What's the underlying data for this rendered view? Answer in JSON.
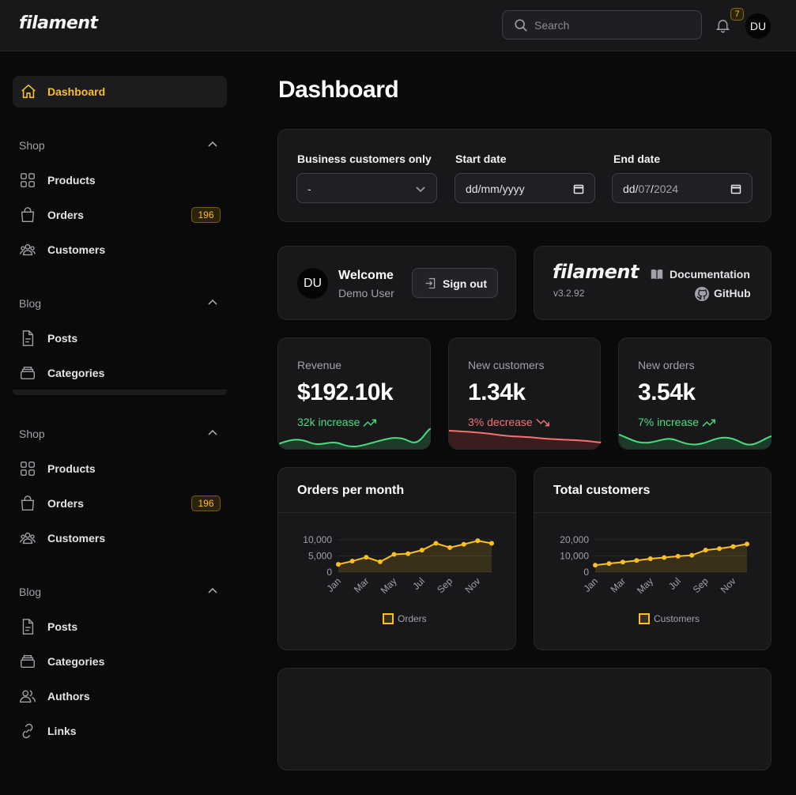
{
  "topbar": {
    "logo": "filament",
    "search_placeholder": "Search",
    "notification_count": "7",
    "user_initials": "DU",
    "icons": [
      "search-icon",
      "bell-icon"
    ]
  },
  "sidebar": {
    "dashboard_label": "Dashboard",
    "groups": [
      {
        "label": "Shop",
        "items": [
          {
            "label": "Products",
            "icon": "grid-icon"
          },
          {
            "label": "Orders",
            "icon": "shopping-bag-icon",
            "badge": "196"
          },
          {
            "label": "Customers",
            "icon": "users-icon"
          }
        ]
      },
      {
        "label": "Blog",
        "items": [
          {
            "label": "Posts",
            "icon": "document-icon"
          },
          {
            "label": "Categories",
            "icon": "folder-icon"
          }
        ]
      },
      {
        "label": "Shop",
        "items": [
          {
            "label": "Products",
            "icon": "grid-icon"
          },
          {
            "label": "Orders",
            "icon": "shopping-bag-icon",
            "badge": "196"
          },
          {
            "label": "Customers",
            "icon": "users-icon"
          }
        ]
      },
      {
        "label": "Blog",
        "items": [
          {
            "label": "Posts",
            "icon": "document-icon"
          },
          {
            "label": "Categories",
            "icon": "folder-icon"
          },
          {
            "label": "Authors",
            "icon": "user-group-icon"
          },
          {
            "label": "Links",
            "icon": "link-icon"
          }
        ]
      }
    ]
  },
  "main": {
    "title": "Dashboard",
    "filters": {
      "business_label": "Business customers only",
      "business_value": "-",
      "start_label": "Start date",
      "start_value": "dd/mm/yyyy",
      "end_label": "End date",
      "end_value_prefix": "dd/",
      "end_value_month": "07",
      "end_value_year": "2024"
    },
    "welcome": {
      "initials": "DU",
      "title": "Welcome",
      "name": "Demo User",
      "sign_out": "Sign out"
    },
    "brand": {
      "logo": "filament",
      "version": "v3.2.92",
      "docs": "Documentation",
      "github": "GitHub"
    },
    "stats": [
      {
        "label": "Revenue",
        "value": "$192.10k",
        "description": "32k increase",
        "trend": "up",
        "color": "#4ade80"
      },
      {
        "label": "New customers",
        "value": "1.34k",
        "description": "3% decrease",
        "trend": "down",
        "color": "#f87171"
      },
      {
        "label": "New orders",
        "value": "3.54k",
        "description": "7% increase",
        "trend": "up",
        "color": "#4ade80"
      }
    ]
  },
  "colors": {
    "accent": "#fbbf24",
    "success": "#4ade80",
    "danger": "#f87171"
  },
  "chart_data": [
    {
      "type": "line",
      "title": "Orders per month",
      "x_tick_labels": [
        "Jan",
        "Mar",
        "May",
        "Jul",
        "Sep",
        "Nov"
      ],
      "x": [
        "Jan",
        "Feb",
        "Mar",
        "Apr",
        "May",
        "Jun",
        "Jul",
        "Aug",
        "Sep",
        "Oct",
        "Nov",
        "Dec"
      ],
      "series": [
        {
          "name": "Orders",
          "values": [
            2400,
            3400,
            4600,
            3200,
            5500,
            5700,
            6800,
            8900,
            7600,
            8600,
            9700,
            8900
          ],
          "color": "#fbbf24"
        }
      ],
      "y_ticks": [
        "10,000",
        "5,000",
        "0"
      ],
      "ylim": [
        0,
        10000
      ],
      "legend": "bottom"
    },
    {
      "type": "line",
      "title": "Total customers",
      "x_tick_labels": [
        "Jan",
        "Mar",
        "May",
        "Jul",
        "Sep",
        "Nov"
      ],
      "x": [
        "Jan",
        "Feb",
        "Mar",
        "Apr",
        "May",
        "Jun",
        "Jul",
        "Aug",
        "Sep",
        "Oct",
        "Nov",
        "Dec"
      ],
      "series": [
        {
          "name": "Customers",
          "values": [
            4300,
            5300,
            6200,
            7200,
            8300,
            9000,
            9800,
            10400,
            13600,
            14500,
            15800,
            17400
          ],
          "color": "#fbbf24"
        }
      ],
      "y_ticks": [
        "20,000",
        "10,000",
        "0"
      ],
      "ylim": [
        0,
        20000
      ],
      "legend": "bottom"
    }
  ]
}
